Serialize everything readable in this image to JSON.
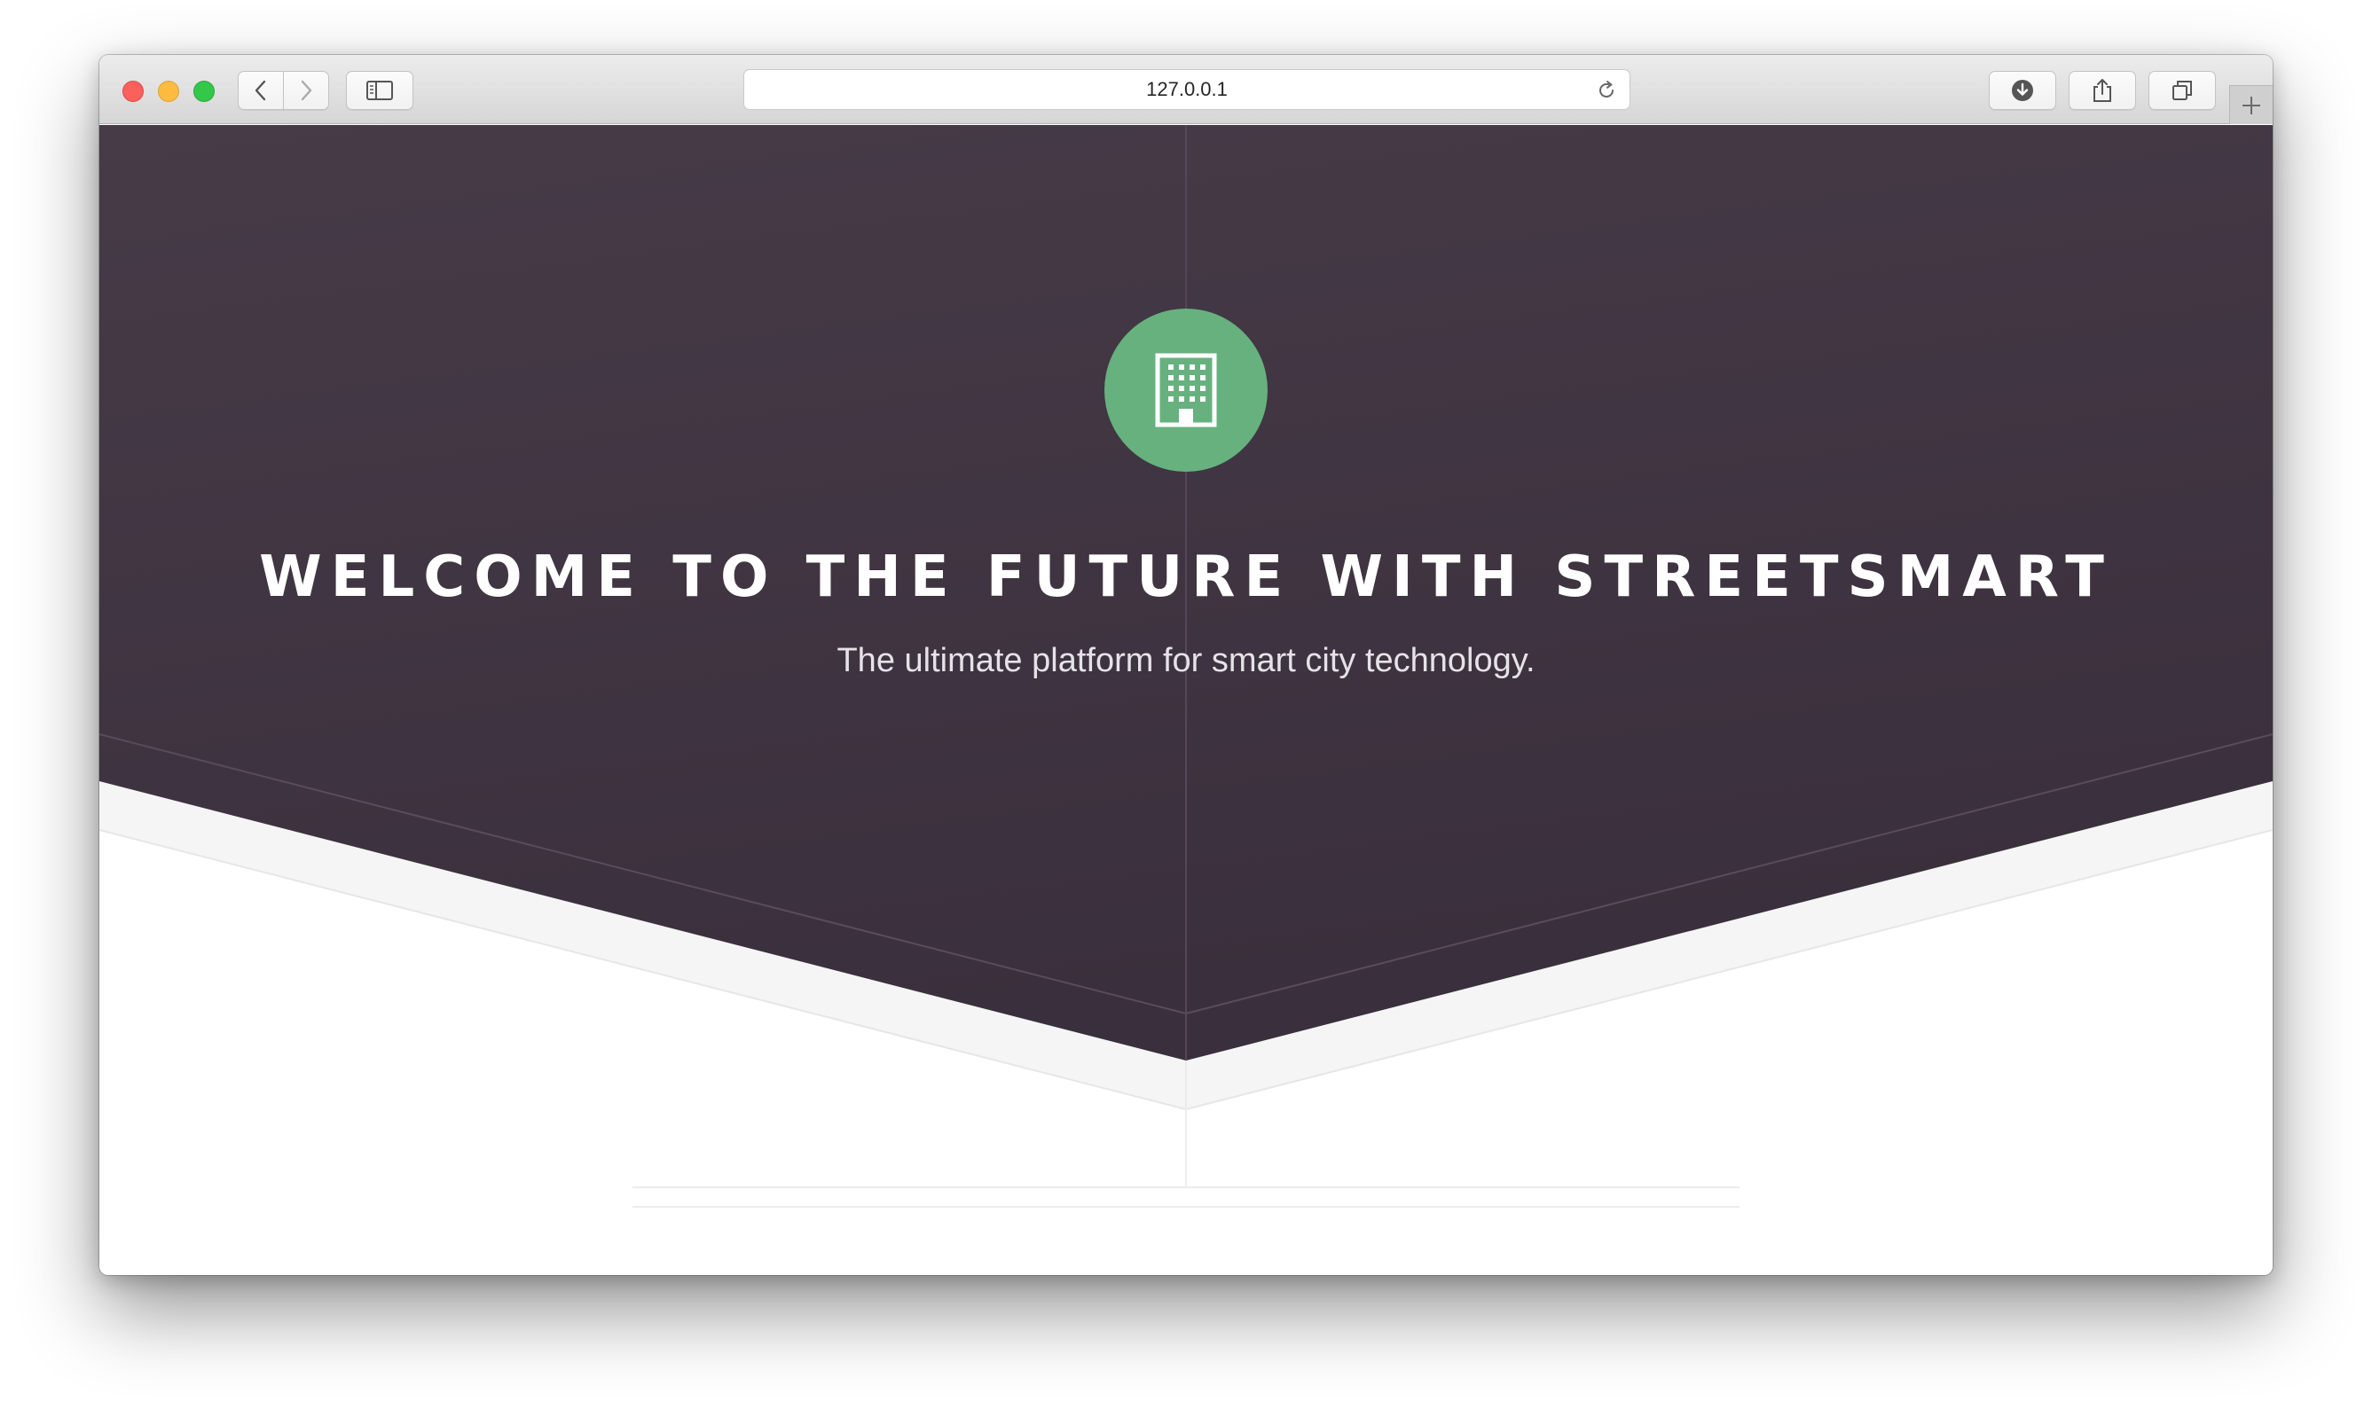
{
  "browser": {
    "url": "127.0.0.1",
    "colors": {
      "toolbar": "#dcdcdc",
      "close": "#fc605c",
      "minimize": "#fdbc40",
      "zoom": "#34c84a"
    },
    "icons": [
      "back-chevron-icon",
      "forward-chevron-icon",
      "sidebar-icon",
      "reload-icon",
      "download-icon",
      "share-icon",
      "tabs-icon",
      "plus-icon"
    ]
  },
  "hero": {
    "icon": "building-icon",
    "title": "WELCOME TO THE FUTURE WITH STREETSMART",
    "subtitle": "The ultimate platform for smart city technology.",
    "colors": {
      "background": "#3f3340",
      "accent": "#67b17f",
      "title": "#ffffff"
    }
  }
}
